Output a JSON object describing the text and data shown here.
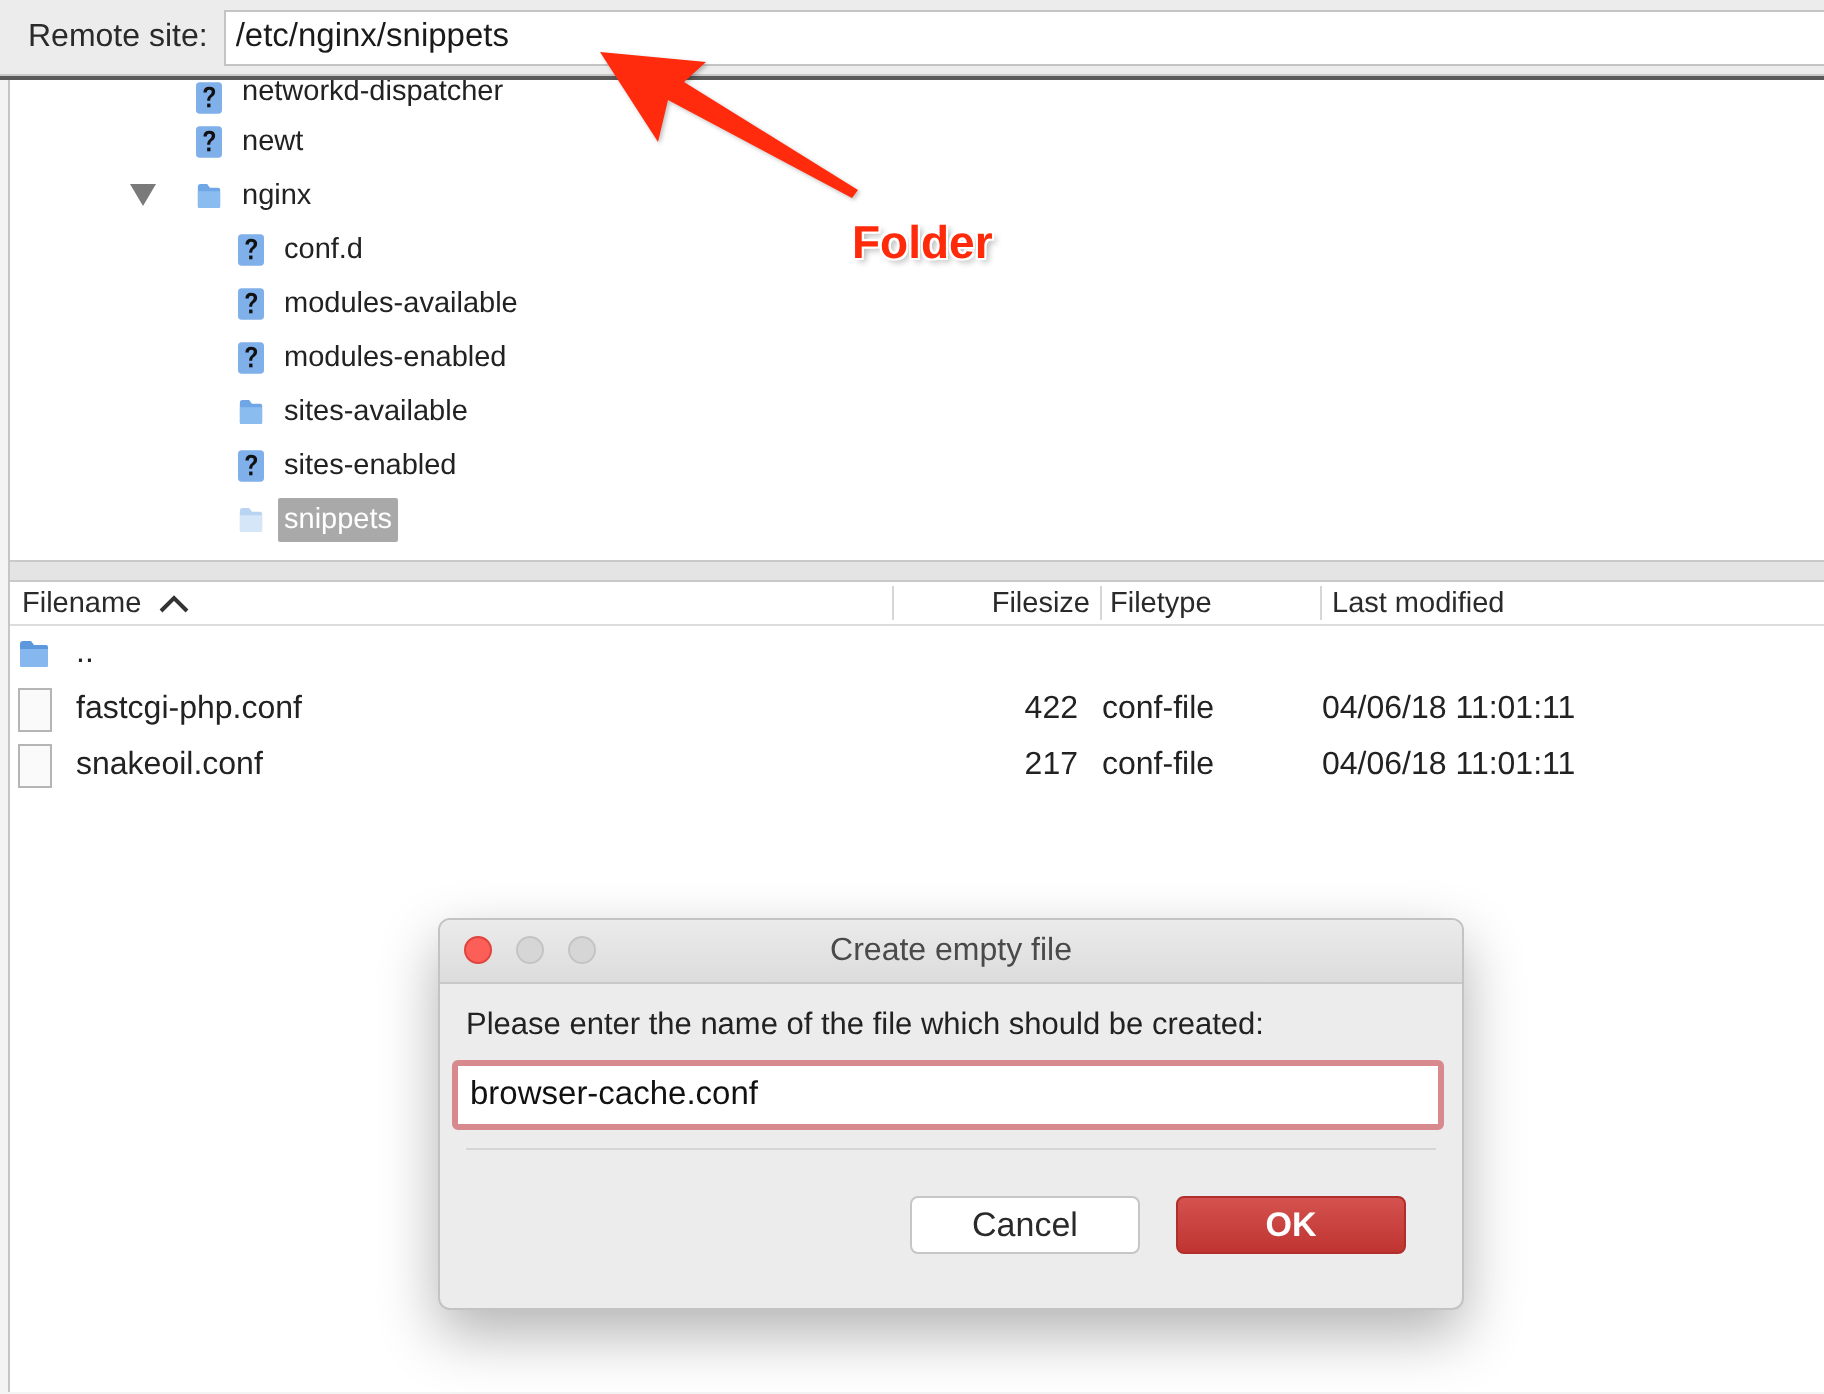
{
  "remote_site": {
    "label": "Remote site:",
    "path": "/etc/nginx/snippets"
  },
  "tree": [
    {
      "name": "networkd-dispatcher",
      "kind": "unknown",
      "selected": false
    },
    {
      "name": "newt",
      "kind": "unknown",
      "selected": false
    },
    {
      "name": "nginx",
      "kind": "folder",
      "selected": false,
      "expanded": true,
      "children": [
        {
          "name": "conf.d",
          "kind": "unknown",
          "selected": false
        },
        {
          "name": "modules-available",
          "kind": "unknown",
          "selected": false
        },
        {
          "name": "modules-enabled",
          "kind": "unknown",
          "selected": false
        },
        {
          "name": "sites-available",
          "kind": "folder",
          "selected": false
        },
        {
          "name": "sites-enabled",
          "kind": "unknown",
          "selected": false
        },
        {
          "name": "snippets",
          "kind": "folder",
          "selected": true
        }
      ]
    }
  ],
  "file_list": {
    "columns": [
      {
        "label": "Filename",
        "sort_ascending": true
      },
      {
        "label": "Filesize"
      },
      {
        "label": "Filetype"
      },
      {
        "label": "Last modified"
      }
    ],
    "rows": [
      {
        "kind": "parent-folder",
        "filename": ".."
      },
      {
        "kind": "file",
        "filename": "fastcgi-php.conf",
        "filesize": "422",
        "filetype": "conf-file",
        "last_modified": "04/06/18 11:01:11"
      },
      {
        "kind": "file",
        "filename": "snakeoil.conf",
        "filesize": "217",
        "filetype": "conf-file",
        "last_modified": "04/06/18 11:01:11"
      }
    ]
  },
  "dialog": {
    "title": "Create empty file",
    "window_controls": [
      {
        "kind": "close",
        "disabled": false
      },
      {
        "kind": "minimize",
        "disabled": true
      },
      {
        "kind": "zoom",
        "disabled": true
      }
    ],
    "prompt": "Please enter the name of the file which should be created:",
    "value": "browser-cache.conf",
    "buttons": [
      {
        "label": "Cancel",
        "kind": "secondary"
      },
      {
        "label": "OK",
        "kind": "default"
      }
    ]
  },
  "annotation": {
    "label": "Folder"
  }
}
